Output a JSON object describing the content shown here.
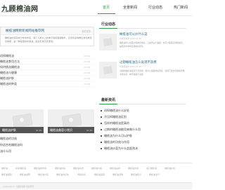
{
  "site": {
    "name": "九顾棉油网",
    "subtitle": "www.jiugumianyou.com"
  },
  "nav": {
    "items": [
      {
        "label": "首页",
        "active": true
      },
      {
        "label": "全景新闻",
        "active": false
      },
      {
        "label": "行业动态",
        "active": false
      },
      {
        "label": "热门新闻",
        "active": false
      }
    ]
  },
  "feature": {
    "title": "橄榄油精致新闻网站推荐网",
    "more": "查看更多",
    "text": "橄榄油的营养成分非常丰富，除了九成以上的单不饱和脂肪酸外，还含有多种维生素和抗氧化物质，是一种健康的食用油，适合日常烹饪使用。"
  },
  "left_list": [
    {
      "title": "初榨橄榄油",
      "date": "07-30"
    },
    {
      "title": "橄榄油食用方法",
      "date": "07-30"
    },
    {
      "title": "如何挑选橄榄油",
      "date": "07-30"
    },
    {
      "title": "橄榄油与健康",
      "date": "07-30"
    },
    {
      "title": "橄榄油护肤",
      "date": "07-30"
    },
    {
      "title": "橄榄油的种类",
      "date": "07-30"
    }
  ],
  "photos": [
    {
      "caption": "橄榄油护肤",
      "date": "07-30"
    },
    {
      "caption": "橄榄油美容小常识",
      "date": "07-30"
    }
  ],
  "lower_list": [
    {
      "title": "橄榄油的功效"
    },
    {
      "title": "你适合吃橄榄油吗"
    },
    {
      "title": "油什么用"
    }
  ],
  "industry": {
    "heading": "行业动态",
    "items": [
      {
        "headline": "橄榄油可以炒什么菜",
        "meta": "管理员发布  2022-07-30",
        "excerpt": "橄榄油可以用来炒各种家常菜，口感清淡不油腻，也可以用来凉拌和烘焙，是厨房中非常实用的好帮手。"
      },
      {
        "headline": "过期橄榄油怎么处理不浪费",
        "meta": "管理员发布  2022-07-30",
        "excerpt": "过期的橄榄油虽然不宜食用，但可以用来擦拭皮具、润滑门窗合页或者护理木质家具，物尽其用不浪费。"
      }
    ]
  },
  "latest": {
    "heading": "最新资讯",
    "items": [
      "初榨橄榄油什么好处",
      "冷压榨橄榄油区别",
      "怎样的橄榄油是真的",
      "过期的橄榄油能用来做什么用",
      "橄榄油为什么可以护肤",
      "橄榄油的功效与作用",
      "橄榄油炒菜为什么会起泡沫"
    ]
  },
  "footer": {
    "links": [
      "橄榄油",
      "初榨橄榄油",
      "橄榄油的作用",
      "橄榄油护肤",
      "橄榄油功效",
      "橄榄油价格",
      "橄榄油品牌",
      "橄榄油食用",
      "进口橄榄油",
      "橄榄油护发",
      "橄榄油面膜",
      "橄榄油减肥",
      "橄榄油炒菜",
      "橄榄油的好处",
      "特级初榨",
      "橄榄油美容",
      "橄榄油选购",
      "橄榄油知识",
      "橄榄油资讯"
    ],
    "copyright": "Copyright © 九顾棉油网 版权所有"
  },
  "colors": {
    "accent": "#2e9c4a",
    "link": "#2f6e8a"
  }
}
